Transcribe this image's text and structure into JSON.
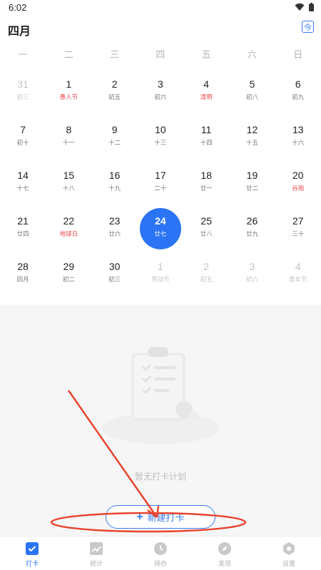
{
  "status_bar": {
    "time": "6:02"
  },
  "header": {
    "month_title": "四月",
    "today_label": "今"
  },
  "weekdays": [
    "一",
    "二",
    "三",
    "四",
    "五",
    "六",
    "日"
  ],
  "calendar": {
    "weeks": [
      [
        {
          "num": "31",
          "sub": "初三",
          "dim": true,
          "red": false
        },
        {
          "num": "1",
          "sub": "愚人节",
          "dim": false,
          "red": true
        },
        {
          "num": "2",
          "sub": "初五",
          "dim": false,
          "red": false
        },
        {
          "num": "3",
          "sub": "初六",
          "dim": false,
          "red": false
        },
        {
          "num": "4",
          "sub": "清明",
          "dim": false,
          "red": true
        },
        {
          "num": "5",
          "sub": "初八",
          "dim": false,
          "red": false
        },
        {
          "num": "6",
          "sub": "初九",
          "dim": false,
          "red": false
        }
      ],
      [
        {
          "num": "7",
          "sub": "初十",
          "dim": false,
          "red": false
        },
        {
          "num": "8",
          "sub": "十一",
          "dim": false,
          "red": false
        },
        {
          "num": "9",
          "sub": "十二",
          "dim": false,
          "red": false
        },
        {
          "num": "10",
          "sub": "十三",
          "dim": false,
          "red": false
        },
        {
          "num": "11",
          "sub": "十四",
          "dim": false,
          "red": false
        },
        {
          "num": "12",
          "sub": "十五",
          "dim": false,
          "red": false
        },
        {
          "num": "13",
          "sub": "十六",
          "dim": false,
          "red": false
        }
      ],
      [
        {
          "num": "14",
          "sub": "十七",
          "dim": false,
          "red": false
        },
        {
          "num": "15",
          "sub": "十八",
          "dim": false,
          "red": false
        },
        {
          "num": "16",
          "sub": "十九",
          "dim": false,
          "red": false
        },
        {
          "num": "17",
          "sub": "二十",
          "dim": false,
          "red": false
        },
        {
          "num": "18",
          "sub": "廿一",
          "dim": false,
          "red": false
        },
        {
          "num": "19",
          "sub": "廿二",
          "dim": false,
          "red": false
        },
        {
          "num": "20",
          "sub": "谷雨",
          "dim": false,
          "red": true
        }
      ],
      [
        {
          "num": "21",
          "sub": "廿四",
          "dim": false,
          "red": false
        },
        {
          "num": "22",
          "sub": "地球日",
          "dim": false,
          "red": true
        },
        {
          "num": "23",
          "sub": "廿六",
          "dim": false,
          "red": false
        },
        {
          "num": "24",
          "sub": "廿七",
          "dim": false,
          "red": false,
          "today": true
        },
        {
          "num": "25",
          "sub": "廿八",
          "dim": false,
          "red": false
        },
        {
          "num": "26",
          "sub": "廿九",
          "dim": false,
          "red": false
        },
        {
          "num": "27",
          "sub": "三十",
          "dim": false,
          "red": false
        }
      ],
      [
        {
          "num": "28",
          "sub": "四月",
          "dim": false,
          "red": false
        },
        {
          "num": "29",
          "sub": "初二",
          "dim": false,
          "red": false
        },
        {
          "num": "30",
          "sub": "初三",
          "dim": false,
          "red": false
        },
        {
          "num": "1",
          "sub": "劳动节",
          "dim": true,
          "red": true
        },
        {
          "num": "2",
          "sub": "初五",
          "dim": true,
          "red": false
        },
        {
          "num": "3",
          "sub": "初六",
          "dim": true,
          "red": false
        },
        {
          "num": "4",
          "sub": "青年节",
          "dim": true,
          "red": true
        }
      ]
    ]
  },
  "empty_state": {
    "text": "暂无打卡计划",
    "button_label": "新建打卡",
    "illustration_icon": "clipboard-checklist-icon"
  },
  "tabbar": {
    "tabs": [
      {
        "label": "打卡",
        "icon": "checkin-icon",
        "active": true
      },
      {
        "label": "统计",
        "icon": "stats-icon",
        "active": false
      },
      {
        "label": "待办",
        "icon": "clock-icon",
        "active": false
      },
      {
        "label": "发现",
        "icon": "compass-icon",
        "active": false
      },
      {
        "label": "设置",
        "icon": "settings-icon",
        "active": false
      }
    ]
  },
  "colors": {
    "accent": "#2b74f5",
    "holiday_red": "#ec4b4b",
    "annotation_red": "#e8442e",
    "muted": "#b3b3b3"
  }
}
